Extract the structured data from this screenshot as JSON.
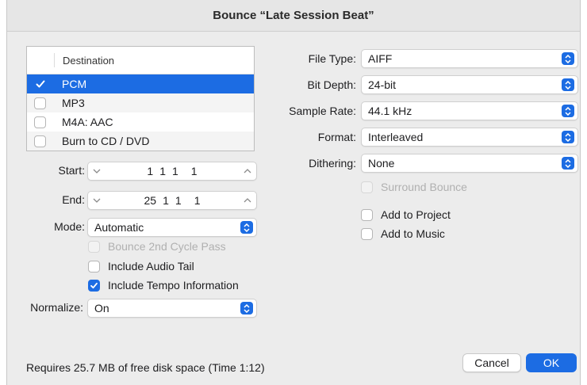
{
  "dialog": {
    "title": "Bounce “Late Session Beat”"
  },
  "destination": {
    "header": "Destination",
    "items": [
      {
        "label": "PCM",
        "checked": true,
        "selected": true
      },
      {
        "label": "MP3",
        "checked": false,
        "selected": false
      },
      {
        "label": "M4A: AAC",
        "checked": false,
        "selected": false
      },
      {
        "label": "Burn to CD / DVD",
        "checked": false,
        "selected": false
      }
    ]
  },
  "range": {
    "start_label": "Start:",
    "start": [
      "1",
      "1",
      "1",
      "1"
    ],
    "end_label": "End:",
    "end": [
      "25",
      "1",
      "1",
      "1"
    ]
  },
  "mode": {
    "label": "Mode:",
    "value": "Automatic"
  },
  "options": {
    "bounce_2nd_cycle": "Bounce 2nd Cycle Pass",
    "include_audio_tail": "Include Audio Tail",
    "include_tempo": "Include Tempo Information"
  },
  "normalize": {
    "label": "Normalize:",
    "value": "On"
  },
  "settings": {
    "file_type": {
      "label": "File Type:",
      "value": "AIFF"
    },
    "bit_depth": {
      "label": "Bit Depth:",
      "value": "24-bit"
    },
    "sample_rate": {
      "label": "Sample Rate:",
      "value": "44.1 kHz"
    },
    "format": {
      "label": "Format:",
      "value": "Interleaved"
    },
    "dithering": {
      "label": "Dithering:",
      "value": "None"
    }
  },
  "right_options": {
    "surround_bounce": "Surround Bounce",
    "add_to_project": "Add to Project",
    "add_to_music": "Add to Music"
  },
  "footer": {
    "disk_space": "Requires 25.7 MB of free disk space  (Time 1:12)",
    "cancel": "Cancel",
    "ok": "OK"
  },
  "colors": {
    "accent": "#1c6ce3",
    "background": "#ececec"
  }
}
